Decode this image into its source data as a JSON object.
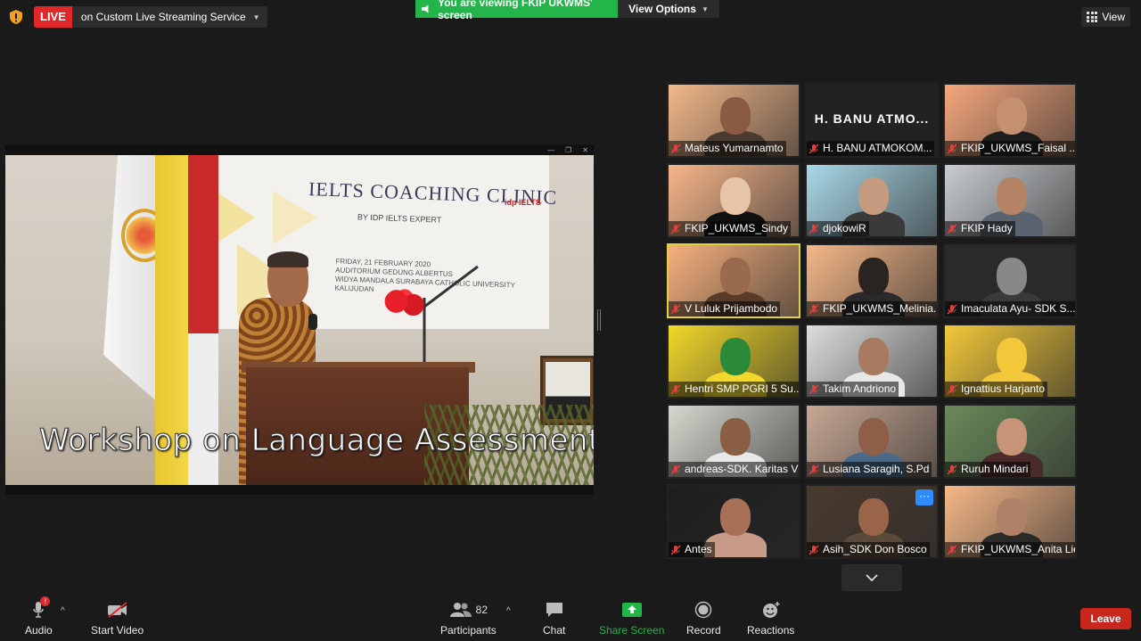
{
  "top_bar": {
    "live_tag": "LIVE",
    "live_service": "on Custom Live Streaming Service",
    "viewing_banner": "You are viewing FKIP UKWMS' screen",
    "view_options": "View Options",
    "view_button": "View"
  },
  "shared_screen": {
    "banner_title": "IELTS COACHING CLINIC",
    "banner_subtitle": "BY IDP IELTS EXPERT",
    "banner_date_line1": "FRIDAY, 21 FEBRUARY 2020",
    "banner_date_line2": "AUDITORIUM GEDUNG ALBERTUS",
    "banner_date_line3": "WIDYA MANDALA SURABAYA CATHOLIC UNIVERSITY",
    "banner_date_line4": "KALIJUDAN",
    "idp_logo": "idp IELTS",
    "overlay_caption": "Workshop on Language Assessment"
  },
  "gallery": {
    "participants": [
      {
        "name": "Mateus Yumarnamto",
        "muted": true,
        "bg": "#f3b98a",
        "face": "#8a5a42",
        "body": "#4a3a30",
        "video": true,
        "active": false
      },
      {
        "name": "H. BANU ATMOKOM...",
        "muted": true,
        "big_name": "H. BANU ATMO...",
        "video": false,
        "active": false
      },
      {
        "name": "FKIP_UKWMS_Faisal ...",
        "muted": true,
        "bg": "#f5a77c",
        "face": "#c49070",
        "body": "#1e1e1e",
        "video": true,
        "active": false
      },
      {
        "name": "FKIP_UKWMS_Sindy",
        "muted": true,
        "bg": "#f7b68a",
        "face": "#e6c4a8",
        "body": "#101010",
        "video": true,
        "active": false
      },
      {
        "name": "djokowiR",
        "muted": true,
        "bg": "#a9d8e8",
        "face": "#c49a80",
        "body": "#3a3a3a",
        "video": true,
        "active": false
      },
      {
        "name": "FKIP Hady",
        "muted": true,
        "bg": "#c8ccd0",
        "face": "#b48264",
        "body": "#5a6470",
        "video": true,
        "active": false
      },
      {
        "name": "V Luluk Prijambodo",
        "muted": true,
        "bg": "#f6b07e",
        "face": "#9a6a4e",
        "body": "#5a3a28",
        "video": true,
        "active": true
      },
      {
        "name": "FKIP_UKWMS_Melinia...",
        "muted": true,
        "bg": "#f6b888",
        "face": "#2a2420",
        "body": "#2a2a2a",
        "video": true,
        "active": false
      },
      {
        "name": "Imaculata Ayu- SDK S...",
        "muted": true,
        "bg": "#2a2a2a",
        "face": "#888888",
        "body": "#3a3a3a",
        "video": true,
        "active": false
      },
      {
        "name": "Hentri SMP PGRI 5 Su...",
        "muted": true,
        "bg": "#f2d82a",
        "face": "#2a8a3a",
        "body": "#f2d82a",
        "video": true,
        "active": false
      },
      {
        "name": "Takim Andriono",
        "muted": true,
        "bg": "#dcdedc",
        "face": "#a87a60",
        "body": "#e8e8e8",
        "video": true,
        "active": false
      },
      {
        "name": "Ignattius Harjanto",
        "muted": true,
        "bg": "#f2c83a",
        "face": "#f2c83a",
        "body": "#f2c83a",
        "video": true,
        "active": false
      },
      {
        "name": "andreas-SDK. Karitas V",
        "muted": true,
        "bg": "#d8d8d0",
        "face": "#8a5e44",
        "body": "#e8e8e8",
        "video": true,
        "active": false
      },
      {
        "name": "Lusiana Saragih, S.Pd",
        "muted": true,
        "bg": "#c8a894",
        "face": "#8e5e48",
        "body": "#4a6a8a",
        "video": true,
        "active": false
      },
      {
        "name": "Ruruh Mindari",
        "muted": true,
        "bg": "#6a8a5a",
        "face": "#c89478",
        "body": "#4a2a2a",
        "video": true,
        "active": false
      },
      {
        "name": "Antes",
        "muted": true,
        "bg": "#1e1e1e",
        "face": "#a87056",
        "body": "#c89a88",
        "video": true,
        "active": false
      },
      {
        "name": "Asih_SDK Don Bosco",
        "muted": true,
        "bg": "#4a3a2e",
        "face": "#9a6448",
        "body": "#5a4a3a",
        "video": true,
        "active": false,
        "more": "···"
      },
      {
        "name": "FKIP_UKWMS_Anita Lie",
        "muted": true,
        "bg": "#f6b888",
        "face": "#b08068",
        "body": "#2a2a2a",
        "video": true,
        "active": false
      }
    ]
  },
  "toolbar": {
    "audio_label": "Audio",
    "audio_badge": "!",
    "video_label": "Start Video",
    "participants_label": "Participants",
    "participants_count": "82",
    "chat_label": "Chat",
    "share_label": "Share Screen",
    "record_label": "Record",
    "reactions_label": "Reactions",
    "leave_label": "Leave"
  },
  "colors": {
    "live_red": "#e02828",
    "share_green": "#23b44a",
    "active_speaker": "#e2d23a",
    "leave_red": "#c8271e",
    "more_blue": "#2d8cff"
  }
}
